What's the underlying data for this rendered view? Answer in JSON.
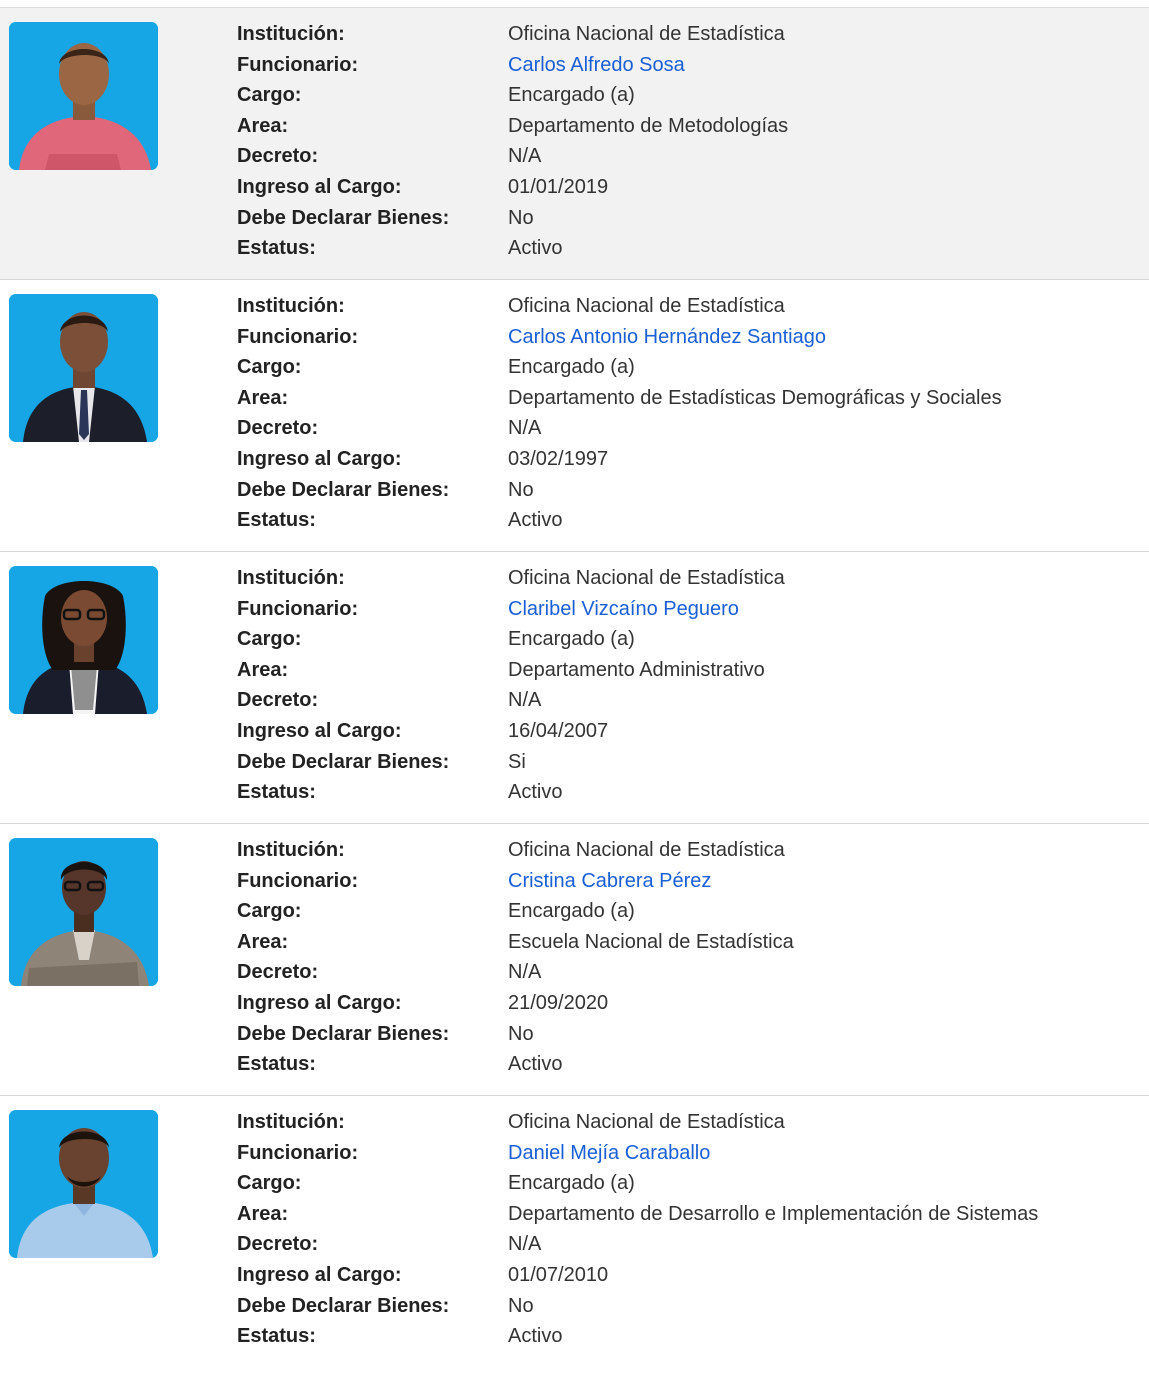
{
  "labels": {
    "institucion": "Institución:",
    "funcionario": "Funcionario:",
    "cargo": "Cargo:",
    "area": "Area:",
    "decreto": "Decreto:",
    "ingreso": "Ingreso al Cargo:",
    "declarar": "Debe Declarar Bienes:",
    "estatus": "Estatus:"
  },
  "colors": {
    "photo_background": "#16a6e6",
    "link": "#1a5fd6",
    "shaded_row": "#f2f2f2"
  },
  "officials": [
    {
      "institucion": "Oficina Nacional de Estadística",
      "funcionario": "Carlos Alfredo Sosa",
      "cargo": "Encargado (a)",
      "area": "Departamento de Metodologías",
      "decreto": "N/A",
      "ingreso": "01/01/2019",
      "declarar": "No",
      "estatus": "Activo",
      "photo_icon": "man-pink-shirt-portrait"
    },
    {
      "institucion": "Oficina Nacional de Estadística",
      "funcionario": "Carlos Antonio Hernández Santiago",
      "cargo": "Encargado (a)",
      "area": "Departamento de Estadísticas Demográficas y Sociales",
      "decreto": "N/A",
      "ingreso": "03/02/1997",
      "declarar": "No",
      "estatus": "Activo",
      "photo_icon": "man-dark-suit-portrait"
    },
    {
      "institucion": "Oficina Nacional de Estadística",
      "funcionario": "Claribel Vizcaíno Peguero",
      "cargo": "Encargado (a)",
      "area": "Departamento Administrativo",
      "decreto": "N/A",
      "ingreso": "16/04/2007",
      "declarar": "Si",
      "estatus": "Activo",
      "photo_icon": "woman-dark-blazer-portrait"
    },
    {
      "institucion": "Oficina Nacional de Estadística",
      "funcionario": "Cristina Cabrera Pérez",
      "cargo": "Encargado (a)",
      "area": "Escuela Nacional de Estadística",
      "decreto": "N/A",
      "ingreso": "21/09/2020",
      "declarar": "No",
      "estatus": "Activo",
      "photo_icon": "woman-gray-blazer-portrait"
    },
    {
      "institucion": "Oficina Nacional de Estadística",
      "funcionario": "Daniel Mejía Caraballo",
      "cargo": "Encargado (a)",
      "area": "Departamento de Desarrollo e Implementación de Sistemas",
      "decreto": "N/A",
      "ingreso": "01/07/2010",
      "declarar": "No",
      "estatus": "Activo",
      "photo_icon": "man-light-blue-shirt-portrait"
    }
  ]
}
